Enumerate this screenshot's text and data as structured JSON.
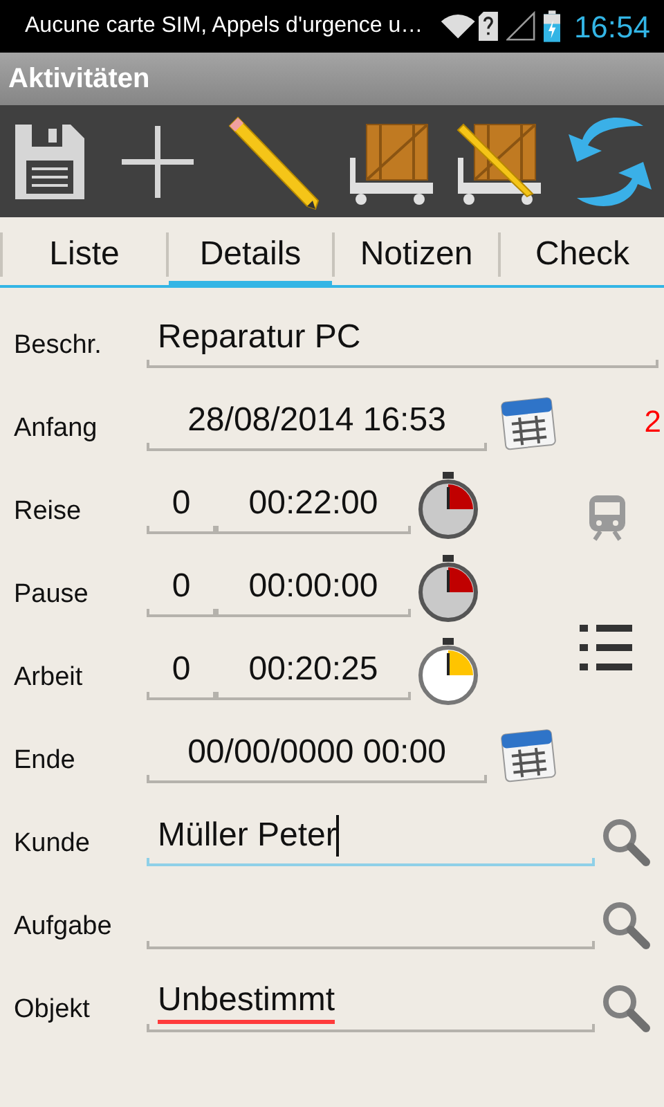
{
  "status_bar": {
    "notification": "Aucune carte SIM, Appels d'urgence u…",
    "time": "16:54"
  },
  "title": "Aktivitäten",
  "tabs": [
    {
      "label": "Liste",
      "selected": false
    },
    {
      "label": "Details",
      "selected": true
    },
    {
      "label": "Notizen",
      "selected": false
    },
    {
      "label": "Check",
      "selected": false
    }
  ],
  "rows": [
    {
      "kind": "text",
      "label": "Beschr.",
      "value": "Reparatur PC"
    },
    {
      "kind": "date",
      "label": "Anfang",
      "value": "28/08/2014 16:53",
      "side_text": "2"
    },
    {
      "kind": "timer",
      "label": "Reise",
      "days": "0",
      "time": "00:22:00",
      "running": false
    },
    {
      "kind": "timer",
      "label": "Pause",
      "days": "0",
      "time": "00:00:00",
      "running": false
    },
    {
      "kind": "timer",
      "label": "Arbeit",
      "days": "0",
      "time": "00:20:25",
      "running": true
    },
    {
      "kind": "date",
      "label": "Ende",
      "value": "00/00/0000 00:00"
    },
    {
      "kind": "lookup",
      "label": "Kunde",
      "value": "Müller Peter",
      "focused": true,
      "misspelled": false
    },
    {
      "kind": "lookup",
      "label": "Aufgabe",
      "focused": false
    },
    {
      "kind": "lookup",
      "label": "Objekt",
      "value": "Unbestimmt",
      "focused": false,
      "misspelled": true
    }
  ]
}
